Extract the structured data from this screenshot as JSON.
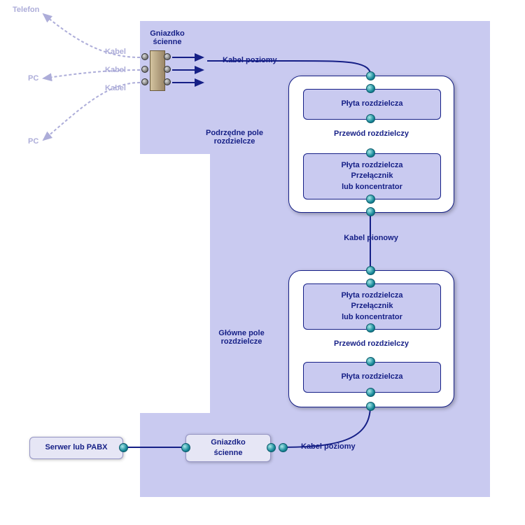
{
  "external": {
    "telefon": "Telefon",
    "pc1": "PC",
    "pc2": "PC",
    "kabel1": "Kabel",
    "kabel2": "Kabel",
    "kabel3": "Kabel"
  },
  "titles": {
    "gniazdko_top": "Gniazdko\nścienne",
    "kabel_poziomy_top": "Kabel poziomy",
    "podrzedne": "Podrzędne pole\nrozdzielcze",
    "kabel_pionowy": "Kabel pionowy",
    "glowne": "Główne pole\nrozdzielcze",
    "kabel_poziomy_bottom": "Kabel poziomy"
  },
  "panel_top": {
    "box1": "Płyta rozdzielcza",
    "mid": "Przewód rozdzielczy",
    "box2": "Płyta rozdzielcza\nPrzełącznik\nlub koncentrator"
  },
  "panel_bottom": {
    "box1": "Płyta rozdzielcza\nPrzełącznik\nlub koncentrator",
    "mid": "Przewód rozdzielczy",
    "box2": "Płyta rozdzielcza"
  },
  "bottom": {
    "serwer": "Serwer lub PABX",
    "gniazdko": "Gniazdko\nścienne"
  }
}
